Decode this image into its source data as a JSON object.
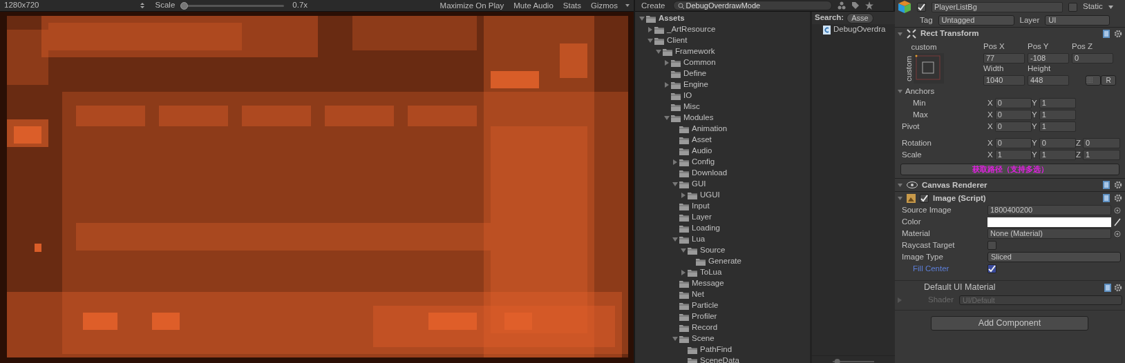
{
  "game_view": {
    "resolution": "1280x720",
    "scale_label": "Scale",
    "scale": {
      "level": 0,
      "reading": "0.7x"
    },
    "buttons": [
      "Maximize On Play",
      "Mute Audio",
      "Stats",
      "Gizmos"
    ]
  },
  "project": {
    "create": "Create",
    "search": {
      "value": "DebugOverdrawMode"
    },
    "tree": [
      {
        "name": "Assets",
        "expanded": true,
        "children": [
          {
            "name": "_ArtResource",
            "expanded": false
          },
          {
            "name": "Client",
            "expanded": true,
            "children": [
              {
                "name": "Framework",
                "expanded": true,
                "children": [
                  {
                    "name": "Common",
                    "expanded": false
                  },
                  {
                    "name": "Define"
                  },
                  {
                    "name": "Engine",
                    "expanded": false
                  },
                  {
                    "name": "IO"
                  },
                  {
                    "name": "Misc"
                  },
                  {
                    "name": "Modules",
                    "expanded": true,
                    "children": [
                      {
                        "name": "Animation"
                      },
                      {
                        "name": "Asset"
                      },
                      {
                        "name": "Audio"
                      },
                      {
                        "name": "Config",
                        "expanded": false
                      },
                      {
                        "name": "Download"
                      },
                      {
                        "name": "GUI",
                        "expanded": true,
                        "children": [
                          {
                            "name": "UGUI",
                            "expanded": false
                          }
                        ]
                      },
                      {
                        "name": "Input"
                      },
                      {
                        "name": "Layer"
                      },
                      {
                        "name": "Loading"
                      },
                      {
                        "name": "Lua",
                        "expanded": true,
                        "children": [
                          {
                            "name": "Source",
                            "expanded": true,
                            "children": [
                              {
                                "name": "Generate"
                              }
                            ]
                          },
                          {
                            "name": "ToLua",
                            "expanded": false
                          }
                        ]
                      },
                      {
                        "name": "Message"
                      },
                      {
                        "name": "Net"
                      },
                      {
                        "name": "Particle"
                      },
                      {
                        "name": "Profiler"
                      },
                      {
                        "name": "Record"
                      },
                      {
                        "name": "Scene",
                        "expanded": true,
                        "children": [
                          {
                            "name": "PathFind"
                          },
                          {
                            "name": "SceneData"
                          }
                        ]
                      }
                    ]
                  }
                ]
              }
            ]
          }
        ]
      }
    ],
    "search_label": "Search:",
    "scope": "Asse",
    "results": [
      "DebugOverdra"
    ],
    "zoom": {
      "level": 0.05
    }
  },
  "inspector": {
    "active": true,
    "name": "PlayerListBg",
    "static_label": "Static",
    "static": false,
    "tag_label": "Tag",
    "tag": "Untagged",
    "layer_label": "Layer",
    "layer": "UI",
    "rect_transform": {
      "title": "Rect Transform",
      "anchor_top": "custom",
      "anchor_side": "custom",
      "pos_labels": [
        "Pos X",
        "Pos Y",
        "Pos Z"
      ],
      "pos_values": [
        "77",
        "-108",
        "0"
      ],
      "size_labels": [
        "Width",
        "Height"
      ],
      "size_values": [
        "1040",
        "448"
      ],
      "raw_button": "R",
      "anchors_label": "Anchors",
      "vectors": [
        {
          "label": "Min",
          "indent": true,
          "cells": [
            {
              "axis": "X",
              "value": "0"
            },
            {
              "axis": "Y",
              "value": "1"
            }
          ]
        },
        {
          "label": "Max",
          "indent": true,
          "cells": [
            {
              "axis": "X",
              "value": "0"
            },
            {
              "axis": "Y",
              "value": "1"
            }
          ]
        },
        {
          "label": "Pivot",
          "indent": false,
          "cells": [
            {
              "axis": "X",
              "value": "0"
            },
            {
              "axis": "Y",
              "value": "1"
            }
          ]
        },
        {
          "label": "Rotation",
          "indent": false,
          "cells": [
            {
              "axis": "X",
              "value": "0"
            },
            {
              "axis": "Y",
              "value": "0"
            },
            {
              "axis": "Z",
              "value": "0"
            }
          ]
        },
        {
          "label": "Scale",
          "indent": false,
          "cells": [
            {
              "axis": "X",
              "value": "1"
            },
            {
              "axis": "Y",
              "value": "1"
            },
            {
              "axis": "Z",
              "value": "1"
            }
          ]
        }
      ],
      "path_button": "获取路径（支持多选）"
    },
    "canvas_renderer": {
      "title": "Canvas Renderer"
    },
    "image": {
      "title": "Image (Script)",
      "enabled": true,
      "fields": [
        {
          "kind": "object",
          "label": "Source Image",
          "value": "1800400200"
        },
        {
          "kind": "color",
          "label": "Color",
          "color": "#ffffff"
        },
        {
          "kind": "object",
          "label": "Material",
          "value": "None (Material)"
        },
        {
          "kind": "check",
          "label": "Raycast Target",
          "checked": false
        },
        {
          "kind": "dropdown",
          "label": "Image Type",
          "value": "Sliced"
        },
        {
          "kind": "check",
          "label": "Fill Center",
          "checked": true,
          "sub": true
        }
      ]
    },
    "material": {
      "title": "Default UI Material",
      "shader_label": "Shader",
      "shader": "UI/Default"
    },
    "add_button": "Add Component"
  }
}
